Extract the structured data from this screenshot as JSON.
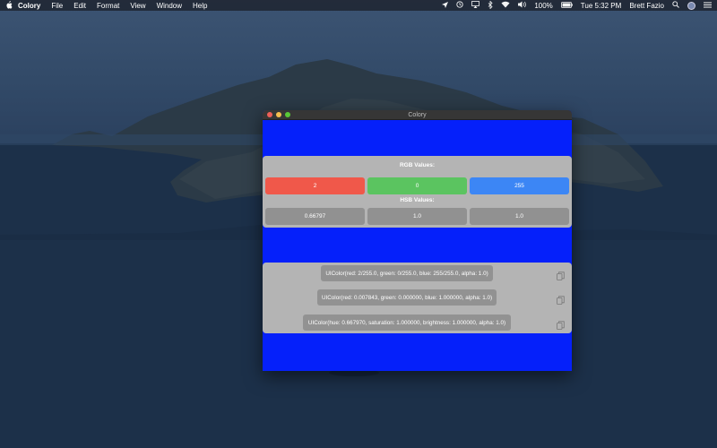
{
  "menubar": {
    "apple_icon": "",
    "app_name": "Colory",
    "menus": [
      "File",
      "Edit",
      "Format",
      "View",
      "Window",
      "Help"
    ],
    "status_icons": [
      "location-icon",
      "time-machine-icon",
      "airplay-icon",
      "bluetooth-icon",
      "wifi-icon",
      "volume-icon"
    ],
    "battery": "100%",
    "battery_icon": "battery-full-icon",
    "clock": "Tue 5:32 PM",
    "user": "Brett Fazio",
    "spotlight_icon": "search-icon",
    "control_icon": "siri-icon"
  },
  "window": {
    "title": "Colory",
    "background_color": "#0520fa"
  },
  "values": {
    "rgb_heading": "RGB Values:",
    "hsb_heading": "HSB Values:",
    "red": "2",
    "green": "0",
    "blue": "255",
    "hue": "0.66797",
    "saturation": "1.0",
    "brightness": "1.0"
  },
  "code": {
    "line1": "UIColor(red: 2/255.0, green: 0/255.0, blue: 255/255.0, alpha: 1.0)",
    "line2": "UIColor(red: 0.007843, green: 0.000000, blue: 1.000000, alpha: 1.0)",
    "line3": "UIColor(hue: 0.667970, saturation: 1.000000, brightness: 1.000000, alpha: 1.0)",
    "copy_icon": "copy-icon"
  },
  "colors": {
    "red_field": "#f0584a",
    "green_field": "#5bc460",
    "blue_field": "#3c86f5",
    "panel": "#b4b4b4"
  }
}
